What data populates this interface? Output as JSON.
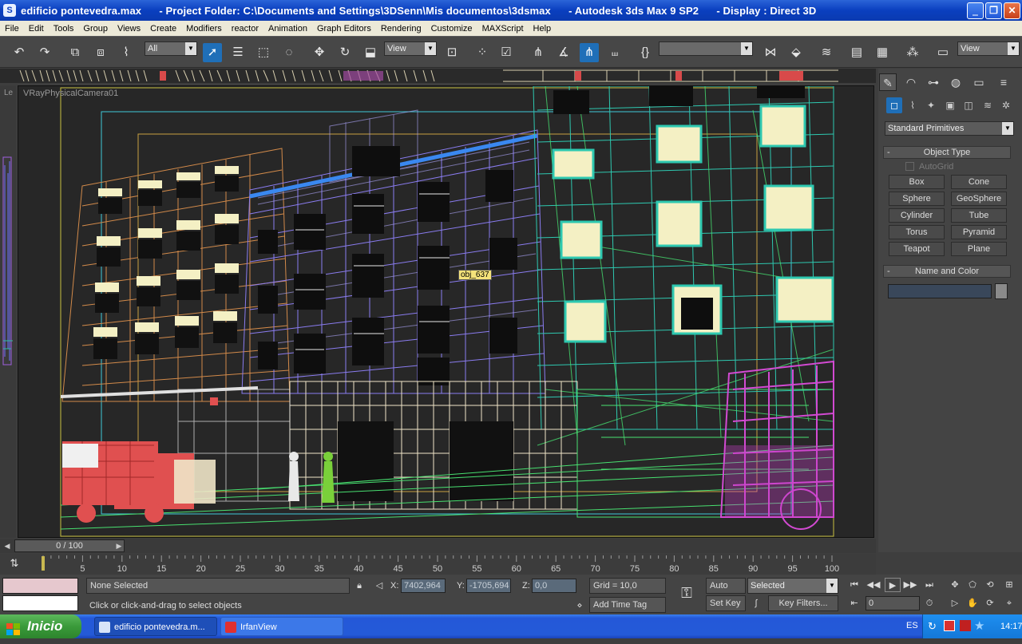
{
  "window": {
    "title": "edificio pontevedra.max      - Project Folder: C:\\Documents and Settings\\3DSenn\\Mis documentos\\3dsmax      - Autodesk 3ds Max 9 SP2      - Display : Direct 3D",
    "minimize": "‗",
    "maximize": "❐",
    "close": "✕"
  },
  "menu": [
    "File",
    "Edit",
    "Tools",
    "Group",
    "Views",
    "Create",
    "Modifiers",
    "reactor",
    "Animation",
    "Graph Editors",
    "Rendering",
    "Customize",
    "MAXScript",
    "Help"
  ],
  "toolbar": {
    "selection_filter": "All",
    "ref_coord": "View",
    "named_selection": "",
    "render_view": "View"
  },
  "viewport": {
    "label": "VRayPhysicalCamera01",
    "left_label": "Le",
    "tooltip": "obj_637"
  },
  "command_panel": {
    "category": "Standard Primitives",
    "object_type_header": "Object Type",
    "autogrid": "AutoGrid",
    "buttons": [
      "Box",
      "Cone",
      "Sphere",
      "GeoSphere",
      "Cylinder",
      "Tube",
      "Torus",
      "Pyramid",
      "Teapot",
      "Plane"
    ],
    "name_color_header": "Name and Color",
    "collapse": "-"
  },
  "timeline": {
    "slider": "0 / 100",
    "ticks": [
      "5",
      "10",
      "15",
      "20",
      "25",
      "30",
      "35",
      "40",
      "45",
      "50",
      "55",
      "60",
      "65",
      "70",
      "75",
      "80",
      "85",
      "90",
      "95",
      "100"
    ]
  },
  "status": {
    "selection": "None Selected",
    "prompt": "Click or click-and-drag to select objects",
    "x_label": "X:",
    "x_value": "7402,964",
    "y_label": "Y:",
    "y_value": "-1705,694",
    "z_label": "Z:",
    "z_value": "0,0",
    "grid": "Grid = 10,0",
    "add_time_tag": "Add Time Tag",
    "auto_key": "Auto Key",
    "set_key": "Set Key",
    "key_mode": "Selected",
    "key_filters": "Key Filters...",
    "frame": "0"
  },
  "taskbar": {
    "start": "Inicio",
    "tasks": [
      "edificio pontevedra.m...",
      "IrfanView"
    ],
    "lang": "ES",
    "clock": "14:17"
  }
}
